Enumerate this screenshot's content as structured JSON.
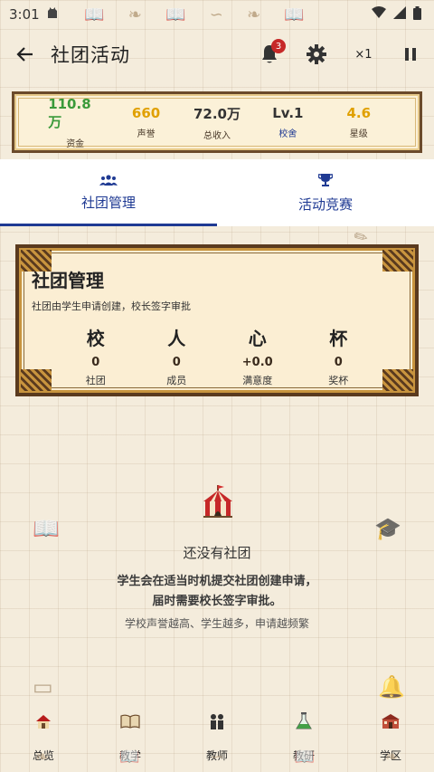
{
  "status_bar": {
    "time": "3:01"
  },
  "header": {
    "title": "社团活动",
    "notification_count": "3",
    "speed": "×1"
  },
  "stats": [
    {
      "value": "110.8万",
      "label": "资金",
      "color": "#3a9a3a"
    },
    {
      "value": "660",
      "label": "声誉",
      "color": "#e0a000"
    },
    {
      "value": "72.0万",
      "label": "总收入",
      "color": "#333333"
    },
    {
      "value": "Lv.1",
      "label": "校舍",
      "color": "#333333"
    },
    {
      "value": "4.6",
      "label": "星级",
      "color": "#e0a000"
    }
  ],
  "tabs": [
    {
      "label": "社团管理",
      "icon": "people-icon",
      "active": true
    },
    {
      "label": "活动竞赛",
      "icon": "trophy-icon",
      "active": false
    }
  ],
  "club_card": {
    "title": "社团管理",
    "subtitle": "社团由学生申请创建，校长签字审批",
    "stats": [
      {
        "glyph": "校",
        "value": "0",
        "label": "社团"
      },
      {
        "glyph": "人",
        "value": "0",
        "label": "成员"
      },
      {
        "glyph": "心",
        "value": "+0.0",
        "label": "满意度"
      },
      {
        "glyph": "杯",
        "value": "0",
        "label": "奖杯"
      }
    ]
  },
  "empty_state": {
    "icon": "circus-tent-icon",
    "title": "还没有社团",
    "description_line1": "学生会在适当时机提交社团创建申请，",
    "description_line2": "届时需要校长签字审批。",
    "hint": "学校声誉越高、学生越多，申请越频繁"
  },
  "bottom_nav": [
    {
      "label": "总览",
      "icon": "house-icon"
    },
    {
      "label": "教学",
      "icon": "book-icon"
    },
    {
      "label": "教师",
      "icon": "teachers-icon"
    },
    {
      "label": "教研",
      "icon": "flask-icon"
    },
    {
      "label": "学区",
      "icon": "school-icon"
    }
  ],
  "colors": {
    "accent": "#1f3a93",
    "frame_dark": "#5a3a1e",
    "frame_gold": "#c8943e",
    "paper": "#f4ecdc"
  }
}
